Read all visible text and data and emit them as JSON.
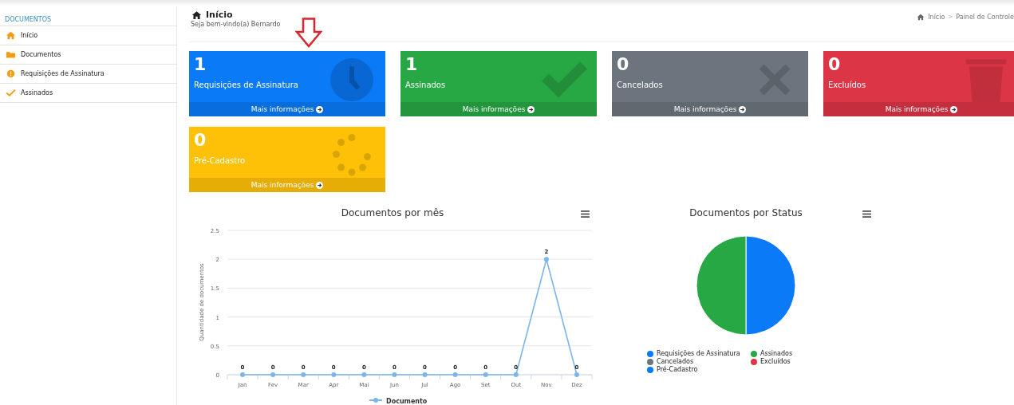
{
  "sidebar": {
    "heading": "DOCUMENTOS",
    "items": [
      {
        "label": "Início",
        "kind": "home"
      },
      {
        "label": "Documentos",
        "kind": "folder"
      },
      {
        "label": "Requisições de Assinatura",
        "kind": "alert"
      },
      {
        "label": "Assinados",
        "kind": "check"
      }
    ]
  },
  "header": {
    "title": "Início",
    "subtitle": "Seja bem-vindo(a) Bernardo",
    "breadcrumb": [
      "Início",
      ">",
      "Painel de Controle"
    ]
  },
  "cards": [
    {
      "count": "1",
      "label": "Requisições de Assinatura",
      "link": "Mais informações",
      "kind": "clock",
      "color": "#0a7af7"
    },
    {
      "count": "1",
      "label": "Assinados",
      "link": "Mais informações",
      "kind": "check",
      "color": "#28a745"
    },
    {
      "count": "0",
      "label": "Cancelados",
      "link": "Mais informações",
      "kind": "times",
      "color": "#6c757d"
    },
    {
      "count": "0",
      "label": "Excluídos",
      "link": "Mais informações",
      "kind": "trash",
      "color": "#dc3545"
    },
    {
      "count": "0",
      "label": "Pré-Cadastro",
      "link": "Mais informações",
      "kind": "spinner",
      "color": "#ffc107"
    }
  ],
  "line_chart": {
    "chart_data": {
      "type": "line",
      "title": "Documentos por mês",
      "ylabel": "Quantidade de documentos",
      "categories": [
        "Jan",
        "Fev",
        "Mar",
        "Apr",
        "Mai",
        "Jun",
        "Jul",
        "Ago",
        "Set",
        "Out",
        "Nov",
        "Dez"
      ],
      "series": [
        {
          "name": "Documento",
          "color": "#7cb5ec",
          "marker": true,
          "values": [
            0,
            0,
            0,
            0,
            0,
            0,
            0,
            0,
            0,
            0,
            2,
            0
          ]
        }
      ],
      "ylim": [
        0,
        2.5
      ],
      "yticks": [
        {
          "value": 0,
          "label": "0"
        },
        {
          "value": 0.5,
          "label": "0.5"
        },
        {
          "value": 1,
          "label": "1"
        },
        {
          "value": 1.5,
          "label": "1.5"
        },
        {
          "value": 2,
          "label": "2"
        },
        {
          "value": 2.5,
          "label": "2.5"
        }
      ],
      "grid": true,
      "value_labels": [
        "0",
        "0",
        "0",
        "0",
        "0",
        "0",
        "0",
        "0",
        "0",
        "0",
        "2",
        "0"
      ],
      "legend": true
    }
  },
  "pie_chart": {
    "chart_data": {
      "type": "pie",
      "title": "Documentos por Status",
      "categories": [
        "Requisições de Assinatura",
        "Assinados",
        "Cancelados",
        "Excluídos",
        "Pré-Cadastro"
      ],
      "series": [
        {
          "colors": [
            "#0a7af7",
            "#28a745",
            "#6c757d",
            "#dc3545",
            "#0a7af7"
          ],
          "values": [
            50,
            50,
            0,
            0,
            0
          ]
        }
      ],
      "legend": true
    }
  }
}
